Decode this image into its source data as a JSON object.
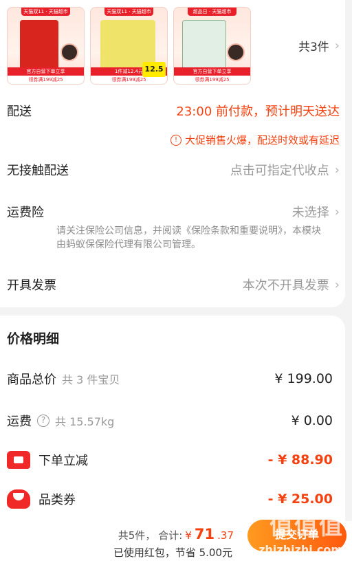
{
  "products": {
    "items": [
      {
        "tag": "天猫双11 · 天猫超市",
        "bar": "官方自营下单立享",
        "sub": "领券满199减25",
        "color": "#d8261e",
        "price": ""
      },
      {
        "tag": "天猫双11 · 天猫超市",
        "bar": "1件减12.4元",
        "sub": "领券满199减25",
        "color": "#f0e36a",
        "price": "12.5"
      },
      {
        "tag": "超品日 · 天猫超市",
        "bar": "官方自营下单立享",
        "sub": "领券满199减25",
        "color": "#e2efe4",
        "price": ""
      }
    ],
    "count_label": "共3件"
  },
  "delivery": {
    "label": "配送",
    "value": "23:00 前付款，预计明天送达"
  },
  "notice": {
    "icon": "!",
    "text": "大促销售火爆，配送时效或有延迟"
  },
  "contactless": {
    "label": "无接触配送",
    "value": "点击可指定代收点"
  },
  "insurance": {
    "label": "运费险",
    "value": "未选择",
    "desc": "请关注保险公司信息，并阅读《保险条款和重要说明》，本模块由蚂蚁保保险代理有限公司管理。"
  },
  "invoice": {
    "label": "开具发票",
    "value": "本次不开具发票"
  },
  "price_detail": {
    "title": "价格明细",
    "goods": {
      "label": "商品总价",
      "sub": "共 3 件宝贝",
      "value": "¥ 199.00"
    },
    "shipping": {
      "label": "运费",
      "sub": "共 15.57kg",
      "value": "¥ 0.00"
    },
    "discount": {
      "label": "下单立减",
      "value": "- ¥ 88.90"
    },
    "coupon": {
      "label": "品类券",
      "value": "- ¥ 25.00"
    }
  },
  "footer": {
    "items_count": "共5件，",
    "total_label": "合计:",
    "currency": "¥",
    "total_int": "71",
    "total_dec": ".37",
    "saved": "已使用红包，节省 5.00元",
    "submit": "提交订单"
  },
  "watermark": {
    "text": "值值值",
    "url": "zhizhizhi.com"
  },
  "colors": {
    "accent": "#f5410f",
    "brand_red": "#e8202a",
    "button_gradient_start": "#ff9a1f",
    "button_gradient_end": "#ff5a0e"
  }
}
